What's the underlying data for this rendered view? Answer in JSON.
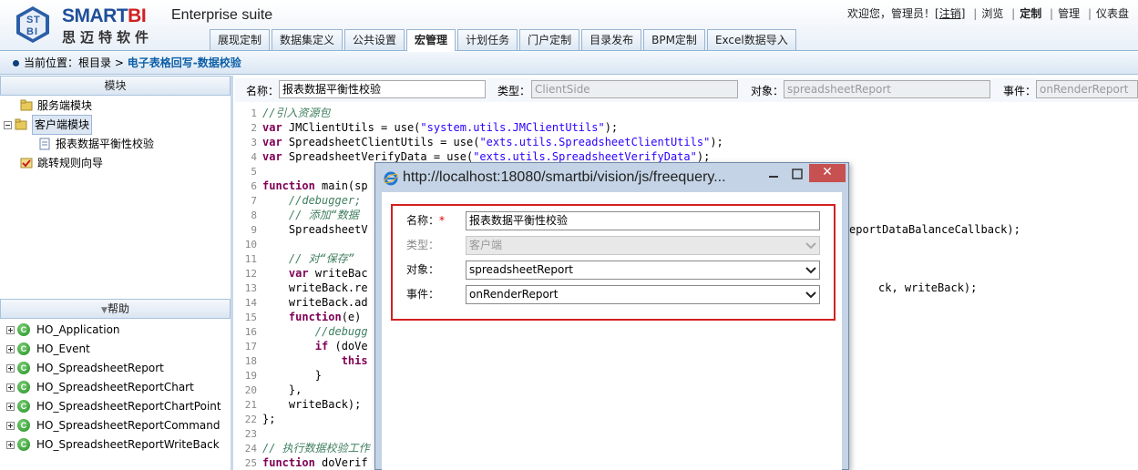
{
  "header": {
    "brand_left": "SMART",
    "brand_right": "BI",
    "brand_sub": "思迈特软件",
    "suite": "Enterprise suite",
    "welcome": "欢迎您，管理员！[",
    "logout": "注销",
    "welcome_end": "]",
    "links": [
      "浏览",
      "定制",
      "管理",
      "仪表盘"
    ]
  },
  "tabs": [
    "展现定制",
    "数据集定义",
    "公共设置",
    "宏管理",
    "计划任务",
    "门户定制",
    "目录发布",
    "BPM定制",
    "Excel数据导入"
  ],
  "active_tab": 3,
  "breadcrumb": {
    "prefix": "当前位置：",
    "root": "根目录",
    "sep": ">",
    "current": "电子表格回写-数据校验"
  },
  "left": {
    "modules_title": "模块",
    "modules": [
      "服务端模块",
      "客户端模块",
      "报表数据平衡性校验",
      "跳转规则向导"
    ],
    "help_title": "帮助",
    "help_items": [
      "HO_Application",
      "HO_Event",
      "HO_SpreadsheetReport",
      "HO_SpreadsheetReportChart",
      "HO_SpreadsheetReportChartPoint",
      "HO_SpreadsheetReportCommand",
      "HO_SpreadsheetReportWriteBack"
    ],
    "help_icon_letter": "C"
  },
  "form": {
    "name_label": "名称：",
    "name_value": "报表数据平衡性校验",
    "type_label": "类型：",
    "type_value": "ClientSide",
    "object_label": "对象：",
    "object_value": "spreadsheetReport",
    "event_label": "事件：",
    "event_value": "onRenderReport"
  },
  "code_lines": [
    {
      "n": "1",
      "t": "//引入资源包"
    },
    {
      "n": "2",
      "t": "var JMClientUtils = use(\"system.utils.JMClientUtils\");"
    },
    {
      "n": "3",
      "t": "var SpreadsheetClientUtils = use(\"exts.utils.SpreadsheetClientUtils\");"
    },
    {
      "n": "4",
      "t": "var SpreadsheetVerifyData = use(\"exts.utils.SpreadsheetVerifyData\");"
    },
    {
      "n": "5",
      "t": ""
    },
    {
      "n": "6",
      "t": "function main(sp"
    },
    {
      "n": "7",
      "t": "    //debugger;"
    },
    {
      "n": "8",
      "t": "    // 添加“数据"
    },
    {
      "n": "9",
      "t": "    SpreadsheetV"
    },
    {
      "n": "10",
      "t": ""
    },
    {
      "n": "11",
      "t": "    // 对“保存”"
    },
    {
      "n": "12",
      "t": "    var writeBac"
    },
    {
      "n": "13",
      "t": "    writeBack.re"
    },
    {
      "n": "14",
      "t": "    writeBack.ad"
    },
    {
      "n": "15",
      "t": "    function(e)"
    },
    {
      "n": "16",
      "t": "        //debugg"
    },
    {
      "n": "17",
      "t": "        if (doVe"
    },
    {
      "n": "18",
      "t": "            this"
    },
    {
      "n": "19",
      "t": "        }"
    },
    {
      "n": "20",
      "t": "    },"
    },
    {
      "n": "21",
      "t": "    writeBack);"
    },
    {
      "n": "22",
      "t": "};"
    },
    {
      "n": "23",
      "t": ""
    },
    {
      "n": "24",
      "t": "// 执行数据校验工作"
    },
    {
      "n": "25",
      "t": "function doVerif"
    }
  ],
  "code_tails": [
    {
      "line": "9",
      "t": "eportDataBalanceCallback);"
    },
    {
      "line": "13",
      "t": "ck, writeBack);"
    }
  ],
  "dialog": {
    "title": "http://localhost:18080/smartbi/vision/js/freequery...",
    "close_glyph": "✕",
    "name_label": "名称：",
    "required": "*",
    "name_value": "报表数据平衡性校验",
    "type_label": "类型：",
    "type_value": "客户端",
    "object_label": "对象：",
    "object_value": "spreadsheetReport",
    "event_label": "事件：",
    "event_value": "onRenderReport"
  },
  "colors": {
    "brand_blue": "#1f4e99",
    "brand_red": "#d21f1f",
    "highlight_red": "#d42020",
    "close_red": "#c75050",
    "comment": "#3f7f5f",
    "keyword": "#7f0055",
    "string": "#2a00ff"
  },
  "icons": [
    "logo-icon",
    "folder-icon",
    "document-icon",
    "wizard-icon",
    "class-icon",
    "ie-icon",
    "minimize-icon",
    "maximize-icon",
    "close-icon",
    "chevron-down-icon"
  ]
}
